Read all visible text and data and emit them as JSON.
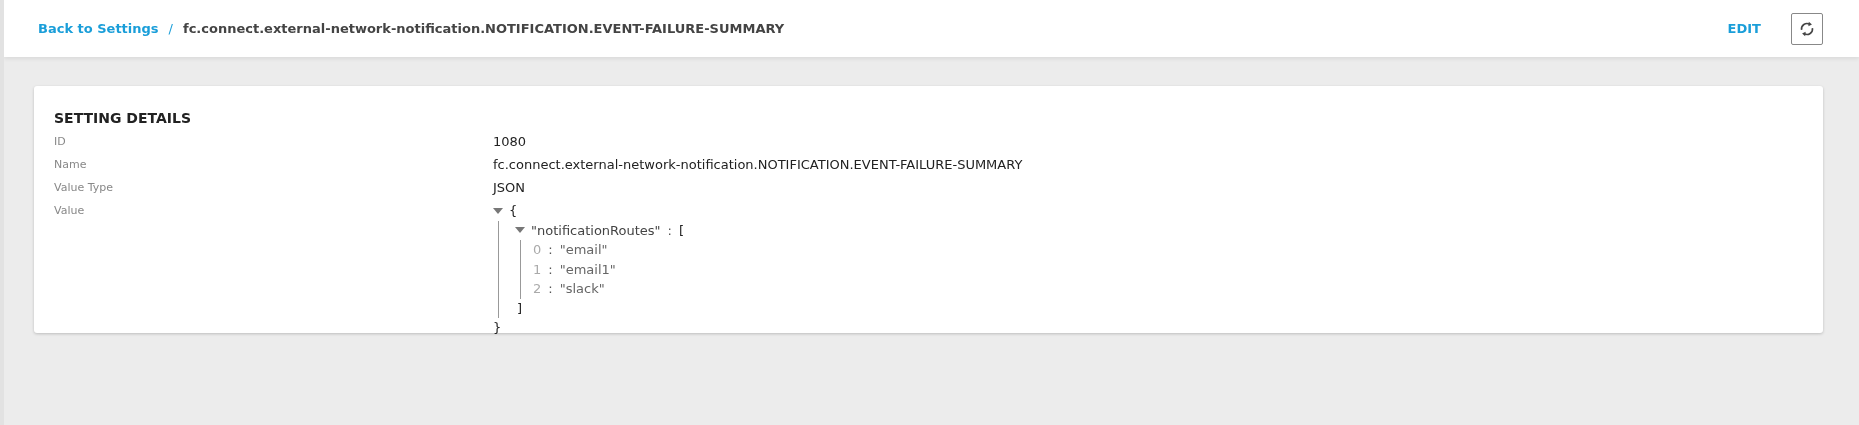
{
  "header": {
    "breadcrumb_link": "Back to Settings",
    "separator": "/",
    "current": "fc.connect.external-network-notification.NOTIFICATION.EVENT-FAILURE-SUMMARY",
    "edit_button": "EDIT"
  },
  "card": {
    "title": "SETTING DETAILS",
    "fields": [
      {
        "label": "ID",
        "value": "1080"
      },
      {
        "label": "Name",
        "value": "fc.connect.external-network-notification.NOTIFICATION.EVENT-FAILURE-SUMMARY"
      },
      {
        "label": "Value Type",
        "value": "JSON"
      }
    ],
    "value_label": "Value",
    "value_tree": {
      "open": "{",
      "close": "}",
      "expanded": true,
      "children": [
        {
          "key": "\"notificationRoutes\"",
          "sep": ":",
          "open": "[",
          "close": "]",
          "expanded": true,
          "children": [
            {
              "index": "0",
              "sep": ":",
              "value": "\"email\""
            },
            {
              "index": "1",
              "sep": ":",
              "value": "\"email1\""
            },
            {
              "index": "2",
              "sep": ":",
              "value": "\"slack\""
            }
          ]
        }
      ]
    }
  }
}
